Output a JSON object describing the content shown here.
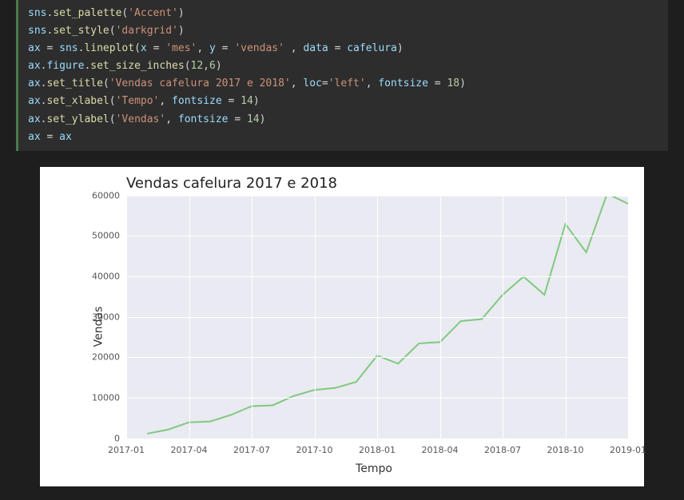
{
  "code": {
    "lines": [
      {
        "raw": "sns.set_palette('Accent')"
      },
      {
        "raw": "sns.set_style('darkgrid')"
      },
      {
        "raw": "ax = sns.lineplot(x = 'mes', y = 'vendas' , data = cafelura)"
      },
      {
        "raw": "ax.figure.set_size_inches(12,6)"
      },
      {
        "raw": "ax.set_title('Vendas cafelura 2017 e 2018', loc='left', fontsize = 18)"
      },
      {
        "raw": "ax.set_xlabel('Tempo', fontsize = 14)"
      },
      {
        "raw": "ax.set_ylabel('Vendas', fontsize = 14)"
      },
      {
        "raw": "ax = ax"
      }
    ]
  },
  "chart_data": {
    "type": "line",
    "title": "Vendas cafelura 2017 e 2018",
    "xlabel": "Tempo",
    "ylabel": "Vendas",
    "ylim": [
      0,
      60000
    ],
    "yticks": [
      0,
      10000,
      20000,
      30000,
      40000,
      50000,
      60000
    ],
    "xticks": [
      "2017-01",
      "2017-04",
      "2017-07",
      "2017-10",
      "2018-01",
      "2018-04",
      "2018-07",
      "2018-10",
      "2019-01"
    ],
    "x": [
      "2017-02",
      "2017-03",
      "2017-04",
      "2017-05",
      "2017-06",
      "2017-07",
      "2017-08",
      "2017-09",
      "2017-10",
      "2017-11",
      "2017-12",
      "2018-01",
      "2018-02",
      "2018-03",
      "2018-04",
      "2018-05",
      "2018-06",
      "2018-07",
      "2018-08",
      "2018-09",
      "2018-10",
      "2018-11",
      "2018-12",
      "2019-01"
    ],
    "values": [
      1200,
      2200,
      4000,
      4200,
      5800,
      8000,
      8200,
      10500,
      12000,
      12500,
      14000,
      20500,
      18500,
      23500,
      23800,
      29000,
      29500,
      35500,
      40000,
      35500,
      53000,
      46000,
      60500,
      58000
    ],
    "line_color": "#7fc97f"
  }
}
